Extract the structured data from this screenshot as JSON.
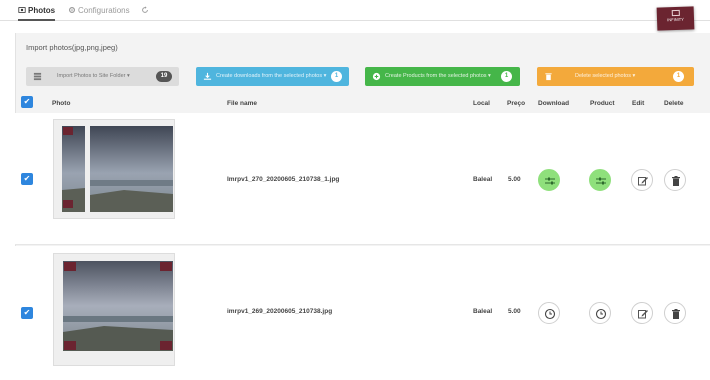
{
  "tabs": [
    {
      "label": "Photos",
      "active": true
    },
    {
      "label": "Configurations",
      "active": false
    }
  ],
  "logo_text": "INFINITY",
  "import_title": "Import photos(jpg,png,jpeg)",
  "actions": {
    "gray": {
      "label": "Import Photos to Site Folder ▾",
      "count": "19"
    },
    "blue": {
      "label": "Create downloads from the selected photos ▾",
      "count": "1"
    },
    "green": {
      "label": "Create Products from the selected photos ▾",
      "count": "1"
    },
    "orange": {
      "label": "Delete selected photos ▾",
      "count": "1"
    }
  },
  "columns": {
    "photo": "Photo",
    "file": "File name",
    "local": "Local",
    "price": "Preço",
    "download": "Download",
    "product": "Product",
    "edit": "Edit",
    "delete": "Delete"
  },
  "rows": [
    {
      "file": "Imrpv1_270_20200605_210738_1.jpg",
      "local": "Baleal",
      "price": "5.00",
      "download_state": "ready",
      "product_state": "ready",
      "selected": true
    },
    {
      "file": "imrpv1_269_20200605_210738.jpg",
      "local": "Baleal",
      "price": "5.00",
      "download_state": "pending",
      "product_state": "pending",
      "selected": true
    }
  ],
  "colors": {
    "accent_blue": "#4fb5de",
    "accent_green": "#45b649",
    "accent_orange": "#f3a93b",
    "ready_green": "#8fe07c"
  }
}
